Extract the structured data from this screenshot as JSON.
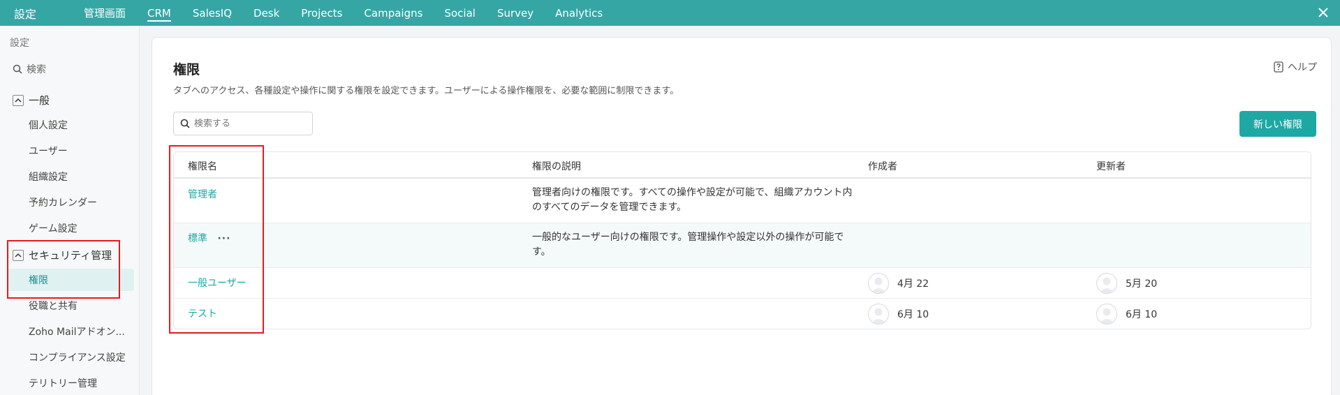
{
  "topbar": {
    "title": "設定",
    "nav": [
      "管理画面",
      "CRM",
      "SalesIQ",
      "Desk",
      "Projects",
      "Campaigns",
      "Social",
      "Survey",
      "Analytics"
    ],
    "active_index": 1,
    "close_icon": "close-icon"
  },
  "sidebar": {
    "title": "設定",
    "search_label": "検索",
    "group_general": "一般",
    "items_general": [
      "個人設定",
      "ユーザー",
      "組織設定",
      "予約カレンダー",
      "ゲーム設定"
    ],
    "group_security": "セキュリティ管理",
    "items_security": [
      "権限",
      "役職と共有",
      "Zoho Mailアドオン...",
      "コンプライアンス設定",
      "テリトリー管理"
    ]
  },
  "main": {
    "title": "権限",
    "description": "タブへのアクセス、各種設定や操作に関する権限を設定できます。ユーザーによる操作権限を、必要な範囲に制限できます。",
    "help_label": "ヘルプ",
    "search_placeholder": "検索する",
    "new_button_label": "新しい権限",
    "columns": [
      "権限名",
      "権限の説明",
      "作成者",
      "更新者"
    ],
    "rows": [
      {
        "name": "管理者",
        "description": "管理者向けの権限です。すべての操作や設定が可能で、組織アカウント内のすべてのデータを管理できます。",
        "created": "",
        "updated": ""
      },
      {
        "name": "標準",
        "more": "···",
        "description": "一般的なユーザー向けの権限です。管理操作や設定以外の操作が可能です。",
        "created": "",
        "updated": ""
      },
      {
        "name": "一般ユーザー",
        "description": "",
        "created": "4月 22",
        "updated": "5月 20"
      },
      {
        "name": "テスト",
        "description": "",
        "created": "6月 10",
        "updated": "6月 10"
      }
    ]
  },
  "colors": {
    "topbar": "#36a6a5",
    "accent": "#1da8a4",
    "highlight_box": "#e8191b"
  }
}
